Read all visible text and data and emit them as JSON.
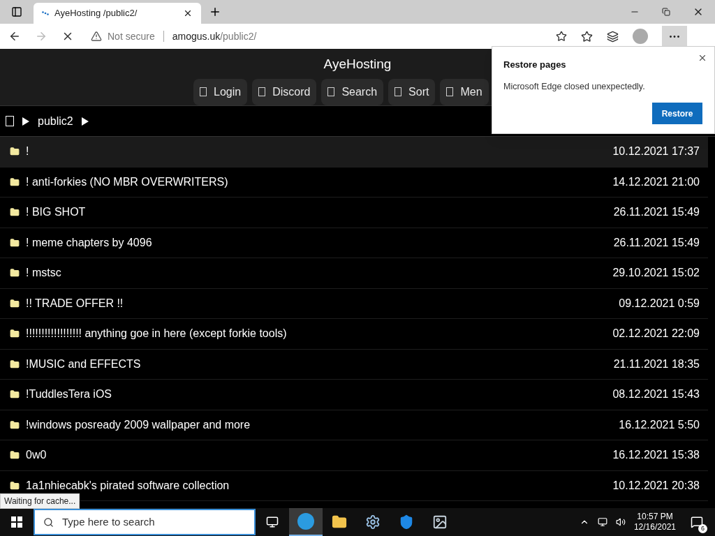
{
  "browser": {
    "tab_title": "AyeHosting /public2/",
    "security": "Not secure",
    "url_host": "amogus.uk",
    "url_path": "/public2/",
    "loading": true
  },
  "site": {
    "title": "AyeHosting",
    "nav": [
      "Login",
      "Discord",
      "Search",
      "Sort",
      "Men"
    ]
  },
  "select_all": {
    "checked": false
  },
  "breadcrumb": [
    "public2"
  ],
  "files": [
    {
      "name": "!",
      "date": "10.12.2021 17:37",
      "selected": true
    },
    {
      "name": "! anti-forkies (NO MBR OVERWRITERS)",
      "date": "14.12.2021 21:00",
      "selected": false
    },
    {
      "name": "! BIG SHOT",
      "date": "26.11.2021 15:49",
      "selected": false
    },
    {
      "name": "! meme chapters by 4096",
      "date": "26.11.2021 15:49",
      "selected": false
    },
    {
      "name": "! mstsc",
      "date": "29.10.2021 15:02",
      "selected": false
    },
    {
      "name": "!! TRADE OFFER !!",
      "date": "09.12.2021 0:59",
      "selected": false
    },
    {
      "name": "!!!!!!!!!!!!!!!!!! anything goe in here (except forkie tools)",
      "date": "02.12.2021 22:09",
      "selected": false
    },
    {
      "name": "!MUSIC and EFFECTS",
      "date": "21.11.2021 18:35",
      "selected": false
    },
    {
      "name": "!TuddlesTera iOS",
      "date": "08.12.2021 15:43",
      "selected": false
    },
    {
      "name": "!windows posready 2009 wallpaper and more",
      "date": "16.12.2021 5:50",
      "selected": false
    },
    {
      "name": "0w0",
      "date": "16.12.2021 15:38",
      "selected": false
    },
    {
      "name": "1a1nhiecabk's pirated software collection",
      "date": "10.12.2021 20:38",
      "selected": false
    }
  ],
  "status": "Waiting for cache...",
  "popup": {
    "title": "Restore pages",
    "message": "Microsoft Edge closed unexpectedly.",
    "button": "Restore"
  },
  "taskbar": {
    "search_placeholder": "Type here to search",
    "time": "10:57 PM",
    "date": "12/16/2021",
    "notifications": "6"
  }
}
